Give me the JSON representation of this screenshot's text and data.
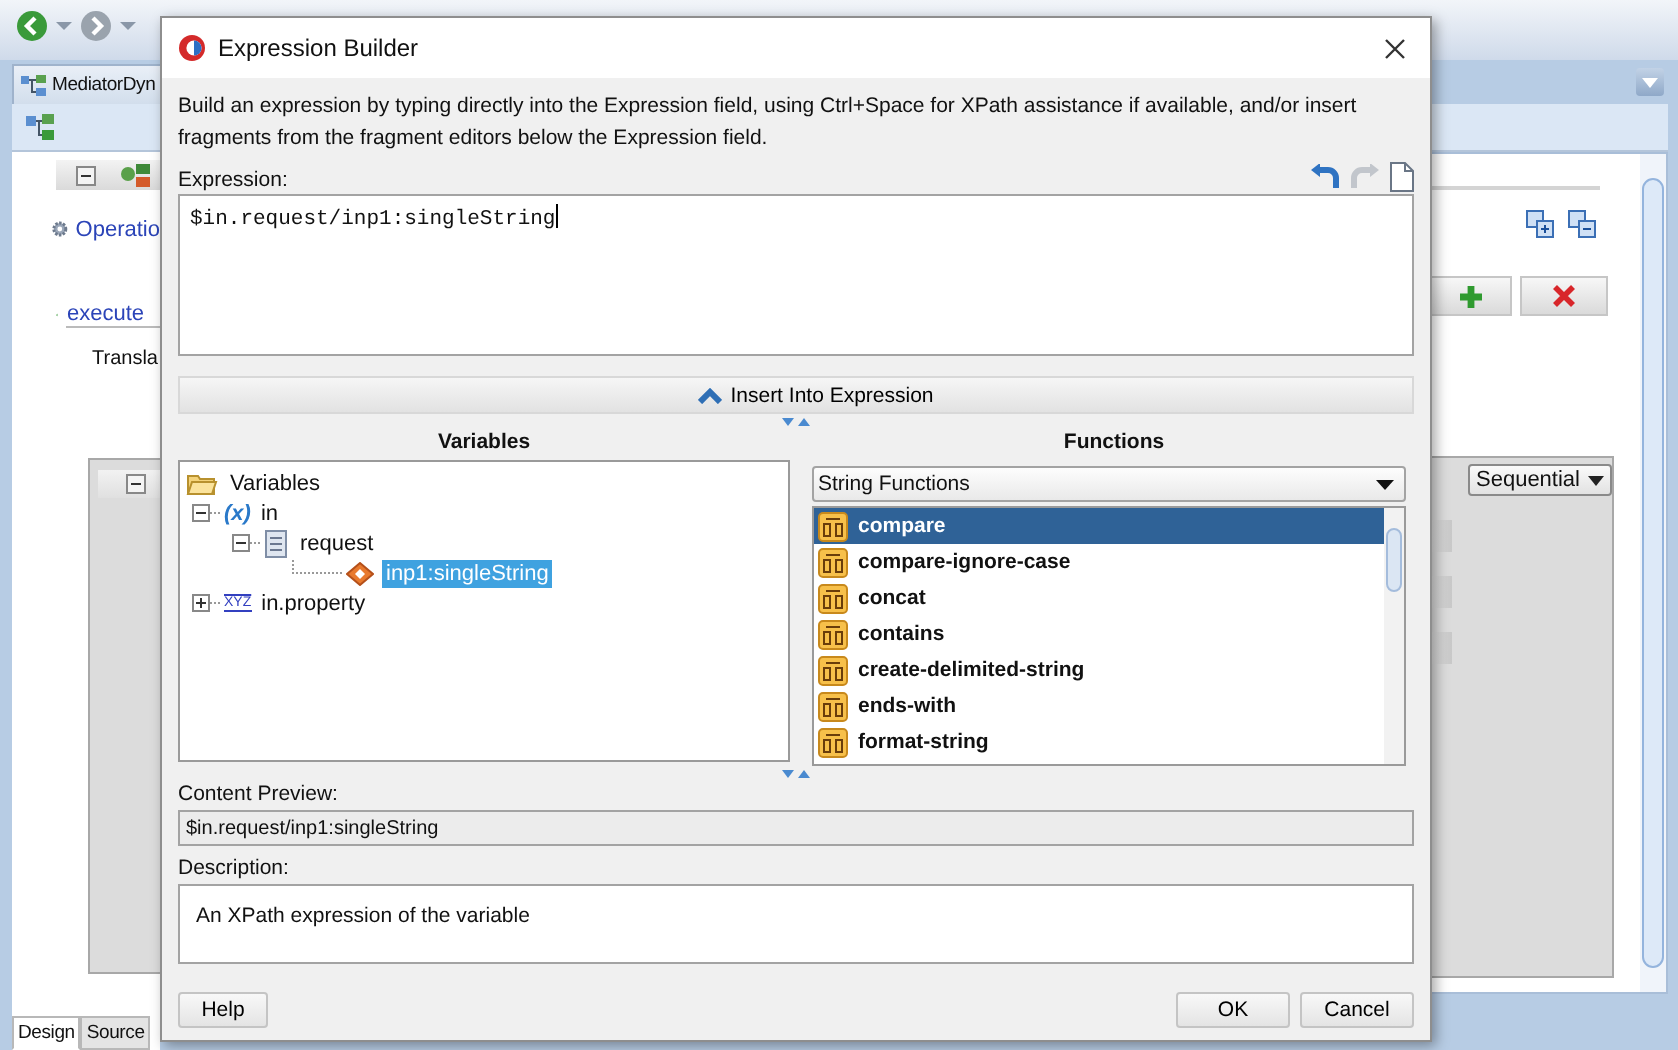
{
  "ide": {
    "editor_tab": "MediatorDyn",
    "operation_link": "Operatio",
    "execute_link": "execute",
    "translate_text": "Transla",
    "execution_type": "Sequential",
    "bottom_tabs": [
      {
        "label": "Design",
        "selected": true
      },
      {
        "label": "Source",
        "selected": false
      }
    ]
  },
  "dialog": {
    "title": "Expression Builder",
    "intro": "Build an expression by typing directly into the Expression field, using Ctrl+Space for XPath assistance if available, and/or insert fragments from the fragment editors below the Expression field.",
    "expression_label": "Expression:",
    "expression": "$in.request/inp1:singleString",
    "insert_button": "Insert Into Expression",
    "variables": {
      "heading": "Variables",
      "tree": [
        {
          "label": "Variables",
          "kind": "folder",
          "selected": false,
          "children": [
            {
              "label": "in",
              "kind": "variable",
              "badge": "(x)",
              "expanded": true,
              "selected": false,
              "children": [
                {
                  "label": "request",
                  "kind": "message",
                  "expanded": true,
                  "selected": false,
                  "children": [
                    {
                      "label": "inp1:singleString",
                      "kind": "element",
                      "selected": true
                    }
                  ]
                }
              ]
            },
            {
              "label": "in.property",
              "kind": "property",
              "badge": "XYZ",
              "expanded": false,
              "selected": false
            }
          ]
        }
      ]
    },
    "functions": {
      "heading": "Functions",
      "category": "String Functions",
      "items": [
        {
          "label": "compare",
          "selected": true
        },
        {
          "label": "compare-ignore-case",
          "selected": false
        },
        {
          "label": "concat",
          "selected": false
        },
        {
          "label": "contains",
          "selected": false
        },
        {
          "label": "create-delimited-string",
          "selected": false
        },
        {
          "label": "ends-with",
          "selected": false
        },
        {
          "label": "format-string",
          "selected": false
        }
      ]
    },
    "content_preview": {
      "label": "Content Preview:",
      "value": "$in.request/inp1:singleString"
    },
    "description": {
      "label": "Description:",
      "text": "An XPath expression of the variable"
    },
    "buttons": [
      "Help",
      "OK",
      "Cancel"
    ]
  }
}
